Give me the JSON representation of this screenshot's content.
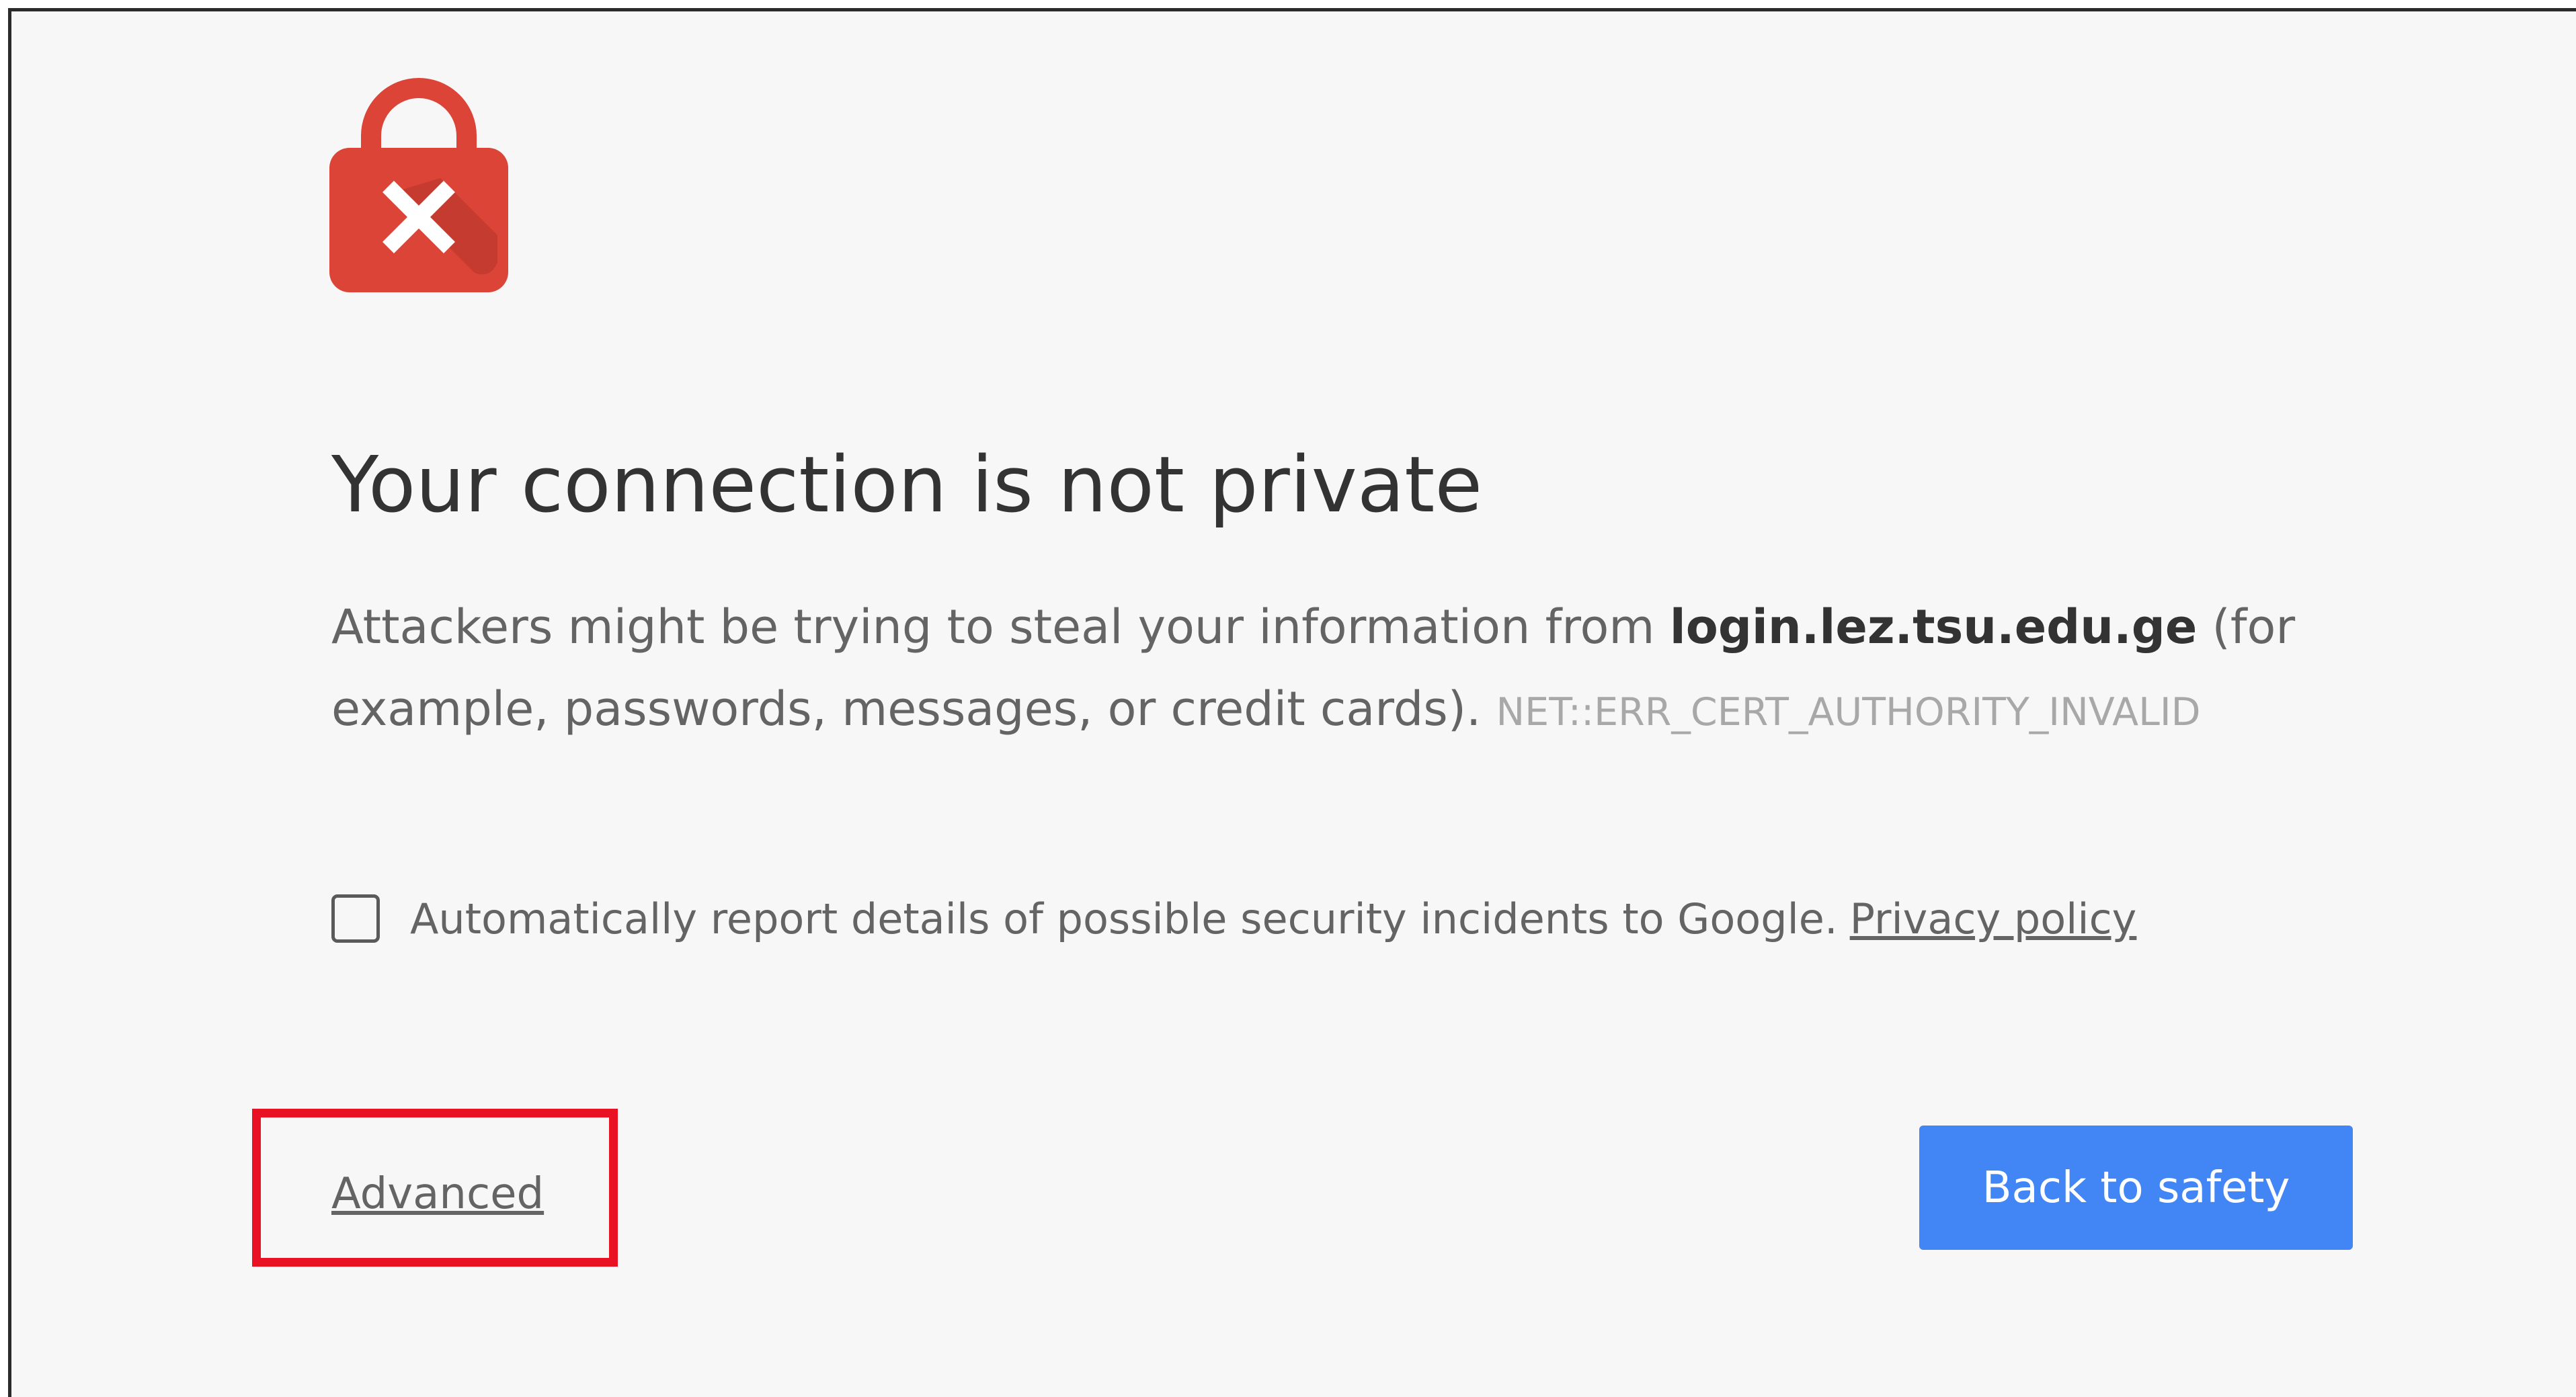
{
  "colors": {
    "page_background": "#f7f7f7",
    "lock_red": "#db4437",
    "button_blue": "#4285f4",
    "highlight_red": "#e81224",
    "text_gray": "#646464"
  },
  "icons": {
    "lock": "lock-with-x-icon"
  },
  "interstitial": {
    "title": "Your connection is not private",
    "description_before": "Attackers might be trying to steal your information from ",
    "domain": "login.lez.tsu.edu.ge",
    "description_after": " (for example, passwords, messages, or credit cards). ",
    "error_code": "NET::ERR_CERT_AUTHORITY_INVALID"
  },
  "report": {
    "checked": false,
    "label": "Automatically report details of possible security incidents to Google.",
    "privacy_link": "Privacy policy"
  },
  "actions": {
    "advanced": "Advanced",
    "back_to_safety": "Back to safety"
  }
}
